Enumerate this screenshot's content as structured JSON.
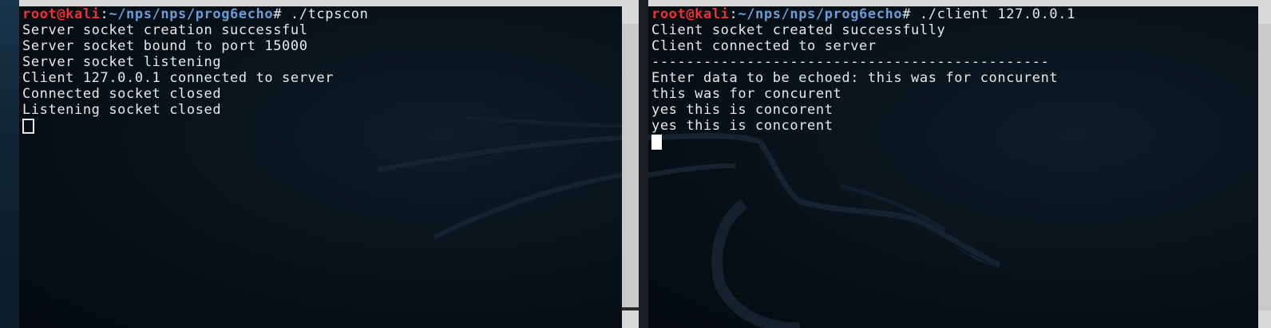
{
  "left_terminal": {
    "prompt": {
      "user_host": "root@kali",
      "colon": ":",
      "path": "~/nps/nps/prog6echo",
      "hash": "#",
      "command": " ./tcpscon"
    },
    "output": [
      "Server socket creation successful",
      "Server socket bound to port 15000",
      "Server socket listening",
      "Client 127.0.0.1 connected to server",
      "Connected socket closed",
      "Listening socket closed"
    ]
  },
  "right_terminal": {
    "prompt": {
      "user_host": "root@kali",
      "colon": ":",
      "path": "~/nps/nps/prog6echo",
      "hash": "#",
      "command": " ./client 127.0.0.1"
    },
    "output": [
      "Client socket created successfully",
      "Client connected to server",
      "----------------------------------------------",
      "Enter data to be echoed: this was for concurent",
      "this was for concurent",
      "yes this is concorent",
      "yes this is concorent"
    ]
  },
  "colors": {
    "prompt_user": "#ee3030",
    "prompt_path": "#6a9cd8",
    "text": "#e8e8e8",
    "background": "#071017"
  },
  "icons": {
    "background_logo": "kali-dragon-icon"
  }
}
